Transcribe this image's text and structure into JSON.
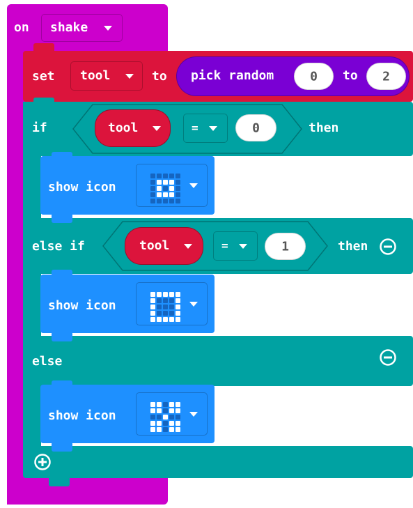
{
  "event": {
    "keyword": "on",
    "trigger": "shake"
  },
  "set_block": {
    "keyword": "set",
    "variable": "tool",
    "to_label": "to",
    "random": {
      "label": "pick random",
      "min": "0",
      "to_label": "to",
      "max": "2"
    }
  },
  "if_block": {
    "if_label": "if",
    "then_label": "then",
    "elseif_label": "else if",
    "else_label": "else",
    "cond1": {
      "variable": "tool",
      "operator": "=",
      "value": "0"
    },
    "cond2": {
      "variable": "tool",
      "operator": "=",
      "value": "1"
    }
  },
  "show_icons": [
    {
      "label": "show icon",
      "pattern": [
        [
          0,
          0,
          0,
          0,
          0
        ],
        [
          0,
          1,
          1,
          1,
          0
        ],
        [
          0,
          1,
          0,
          1,
          0
        ],
        [
          0,
          1,
          1,
          1,
          0
        ],
        [
          0,
          0,
          0,
          0,
          0
        ]
      ]
    },
    {
      "label": "show icon",
      "pattern": [
        [
          1,
          1,
          1,
          1,
          1
        ],
        [
          1,
          0,
          0,
          0,
          1
        ],
        [
          1,
          0,
          0,
          0,
          1
        ],
        [
          1,
          0,
          0,
          0,
          1
        ],
        [
          1,
          1,
          1,
          1,
          1
        ]
      ]
    },
    {
      "label": "show icon",
      "pattern": [
        [
          1,
          1,
          0,
          1,
          1
        ],
        [
          1,
          1,
          0,
          1,
          1
        ],
        [
          0,
          0,
          1,
          0,
          0
        ],
        [
          1,
          1,
          0,
          1,
          1
        ],
        [
          1,
          1,
          0,
          1,
          1
        ]
      ]
    }
  ],
  "colors": {
    "event": "#cc00cc",
    "variables": "#dc143c",
    "math": "#7a00d4",
    "logic": "#00a2a2",
    "basic": "#1e90ff",
    "led_on": "#ffffff",
    "led_off": "#1565c0"
  },
  "icons": [
    "caret-down-icon",
    "remove-else-if-icon",
    "remove-else-icon",
    "add-else-if-icon"
  ]
}
